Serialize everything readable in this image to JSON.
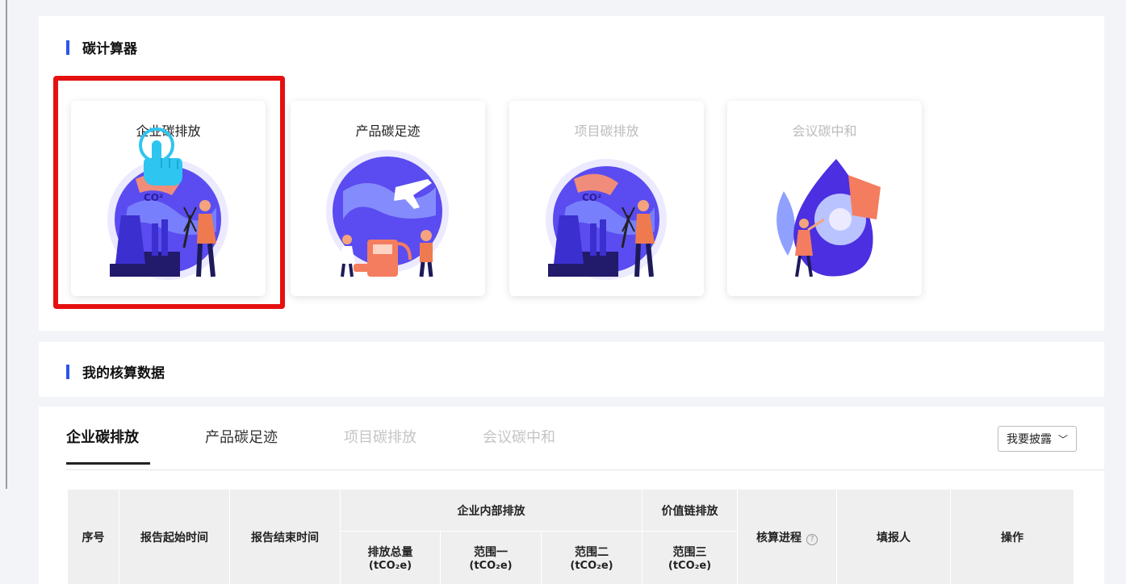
{
  "calculator": {
    "title": "碳计算器",
    "cards": [
      {
        "label": "企业碳排放",
        "enabled": true
      },
      {
        "label": "产品碳足迹",
        "enabled": true
      },
      {
        "label": "项目碳排放",
        "enabled": false
      },
      {
        "label": "会议碳中和",
        "enabled": false
      }
    ]
  },
  "my_data": {
    "title": "我的核算数据"
  },
  "tabs": [
    {
      "label": "企业碳排放",
      "active": true
    },
    {
      "label": "产品碳足迹",
      "active": false
    },
    {
      "label": "项目碳排放",
      "active": false
    },
    {
      "label": "会议碳中和",
      "active": false
    }
  ],
  "disclose_button": {
    "label": "我要披露",
    "icon": "chevron-down-icon"
  },
  "table": {
    "headers": {
      "index": "序号",
      "start": "报告起始时间",
      "end": "报告结束时间",
      "internal": "企业内部排放",
      "value_chain": "价值链排放",
      "total": "排放总量",
      "scope1": "范围一",
      "scope2": "范围二",
      "scope3": "范围三",
      "unit": "(tCO₂e)",
      "progress": "核算进程",
      "filler": "填报人",
      "action": "操作"
    }
  },
  "illustration_text": "CO²",
  "colors": {
    "accent": "#2f54eb",
    "highlight": "#e51010",
    "pointer": "#2ec5f0"
  }
}
